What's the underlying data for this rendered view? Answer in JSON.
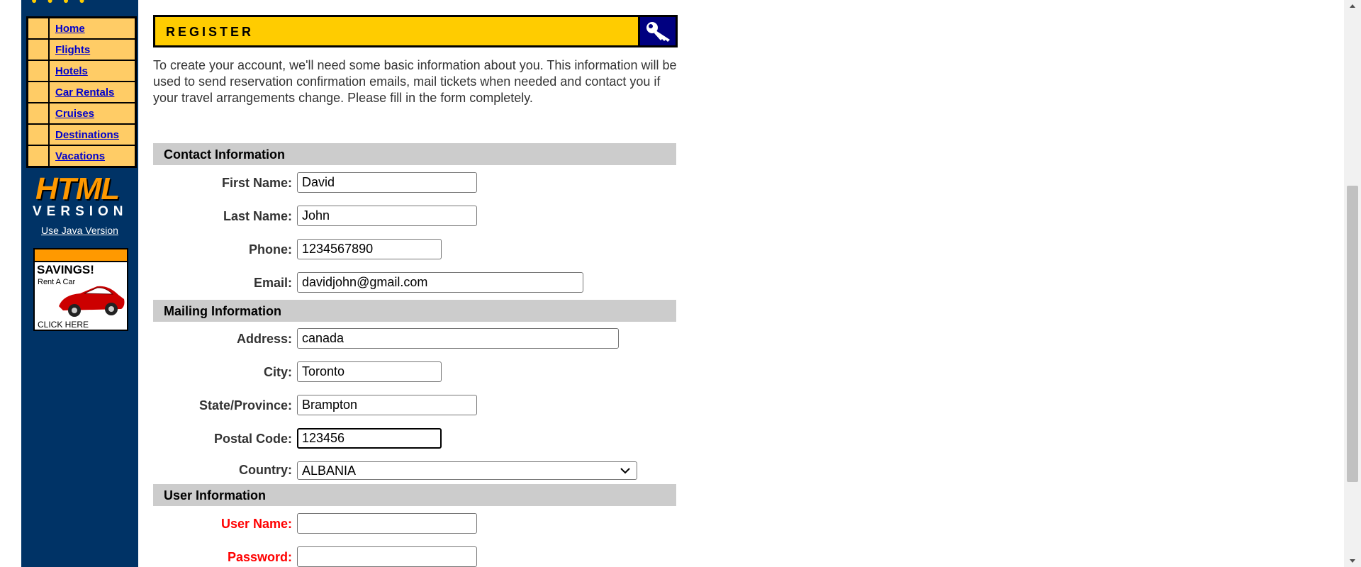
{
  "sidebar": {
    "nav": [
      {
        "label": "Home"
      },
      {
        "label": "Flights"
      },
      {
        "label": "Hotels"
      },
      {
        "label": "Car Rentals"
      },
      {
        "label": "Cruises"
      },
      {
        "label": "Destinations"
      },
      {
        "label": "Vacations"
      }
    ],
    "badge_word": "HTML",
    "badge_version": "VERSION",
    "java_link": "Use Java Version",
    "ad": {
      "title": "SAVINGS!",
      "subtitle": "Rent A Car",
      "cta": "CLICK HERE"
    }
  },
  "register": {
    "title": "REGISTER",
    "intro": "To create your account, we'll need some basic information about you. This information will be used to send reservation confirmation emails, mail tickets when needed and contact you if your travel arrangements change. Please fill in the form completely."
  },
  "sections": {
    "contact": "Contact Information",
    "mailing": "Mailing Information",
    "user": "User Information"
  },
  "fields": {
    "first_name": {
      "label": "First Name:",
      "value": "David"
    },
    "last_name": {
      "label": "Last Name:",
      "value": "John"
    },
    "phone": {
      "label": "Phone:",
      "value": "1234567890"
    },
    "email": {
      "label": "Email:",
      "value": "davidjohn@gmail.com"
    },
    "address": {
      "label": "Address:",
      "value": "canada"
    },
    "city": {
      "label": "City:",
      "value": "Toronto"
    },
    "state": {
      "label": "State/Province:",
      "value": "Brampton"
    },
    "postal": {
      "label": "Postal Code:",
      "value": "123456"
    },
    "country": {
      "label": "Country:",
      "value": "ALBANIA"
    },
    "username": {
      "label": "User Name:",
      "value": ""
    },
    "password": {
      "label": "Password:",
      "value": ""
    }
  },
  "colors": {
    "sidebar_bg": "#003366",
    "nav_bg": "#ffcc66",
    "register_bar": "#ffcc00",
    "section_bg": "#cccccc",
    "required_label": "#ff0000"
  }
}
